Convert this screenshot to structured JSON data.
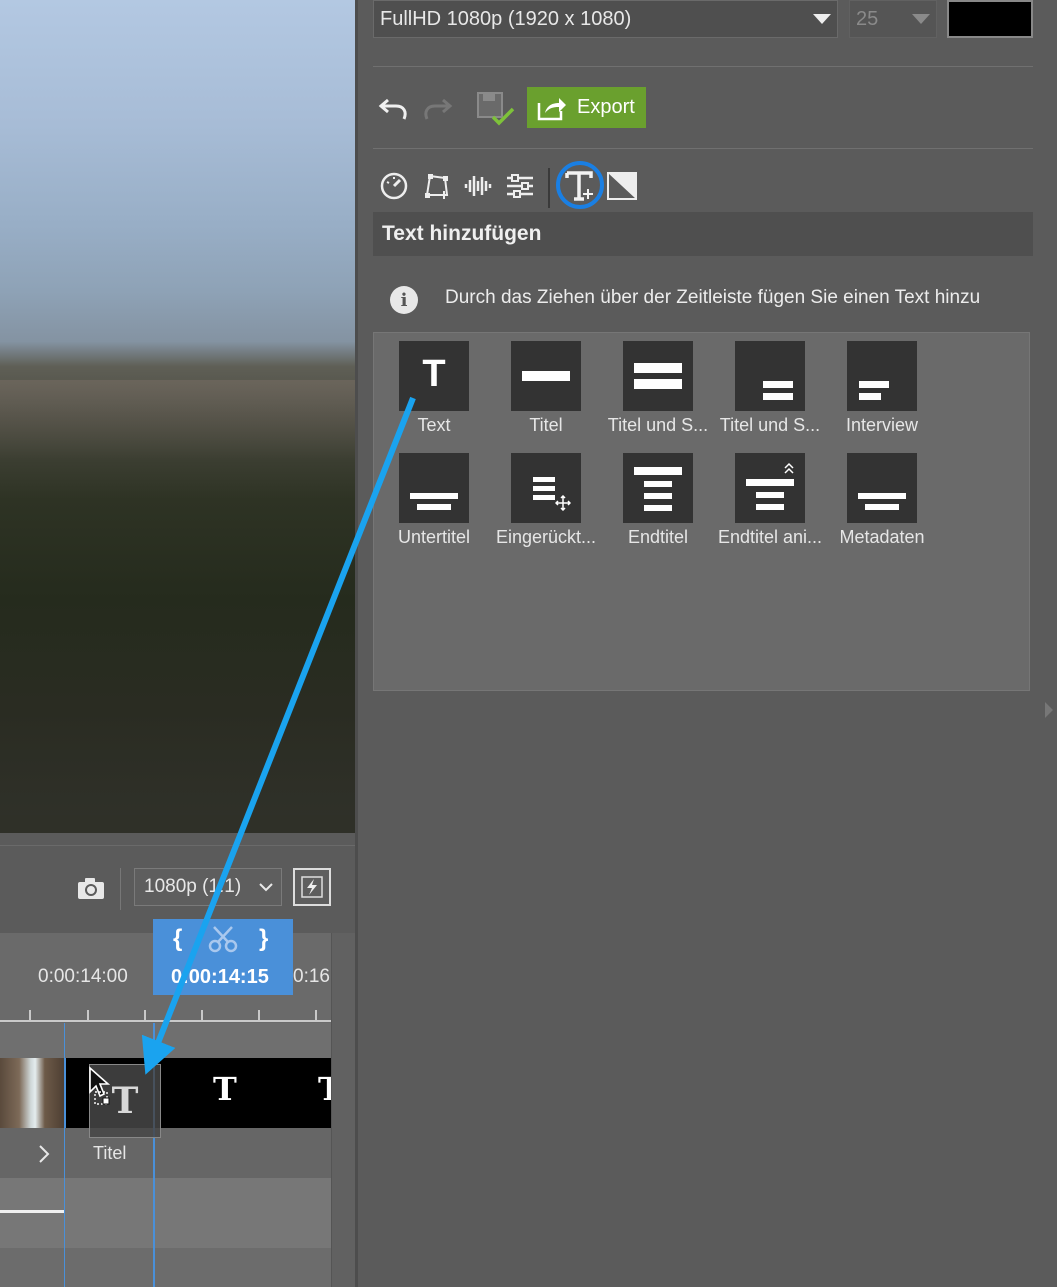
{
  "preview": {
    "timeline_toolbar": {
      "resolution": "1080p (1:1)"
    }
  },
  "timeline": {
    "ruler": {
      "label_left": "0:00:14:00",
      "label_right": "0:16",
      "playhead_time": "0:00:14:15",
      "brace_open": "{",
      "brace_close": "}"
    },
    "text_track_glyph": "T",
    "drag_ghost_glyph": "T",
    "clip_label": "Titel"
  },
  "project": {
    "format": "FullHD 1080p (1920 x 1080)",
    "fps": "25",
    "background_color": "#000000"
  },
  "toolbar": {
    "export_label": "Export"
  },
  "tool_tabs": [
    "speed-icon",
    "transform-icon",
    "audio-icon",
    "adjust-icon",
    "add-text-icon",
    "transition-icon"
  ],
  "section": {
    "title": "Text hinzufügen",
    "info": "Durch das Ziehen über der Zeitleiste fügen Sie einen Text hinzu"
  },
  "presets": [
    {
      "label": "Text",
      "icon": "text-t-icon"
    },
    {
      "label": "Titel",
      "icon": "title-bar-icon"
    },
    {
      "label": "Titel und S...",
      "icon": "title-subtitle-icon"
    },
    {
      "label": "Titel und S...",
      "icon": "title-subtitle-bottom-icon"
    },
    {
      "label": "Interview",
      "icon": "interview-icon"
    },
    {
      "label": "Untertitel",
      "icon": "subtitle-icon"
    },
    {
      "label": "Eingerückt...",
      "icon": "indented-icon"
    },
    {
      "label": "Endtitel",
      "icon": "end-credits-icon"
    },
    {
      "label": "Endtitel ani...",
      "icon": "animated-end-credits-icon"
    },
    {
      "label": "Metadaten",
      "icon": "metadata-icon"
    }
  ],
  "accent_colors": {
    "export": "#6aa02e",
    "highlight": "#1a7fe3",
    "arrow": "#1aa3ef",
    "playhead": "#4a90d9"
  }
}
